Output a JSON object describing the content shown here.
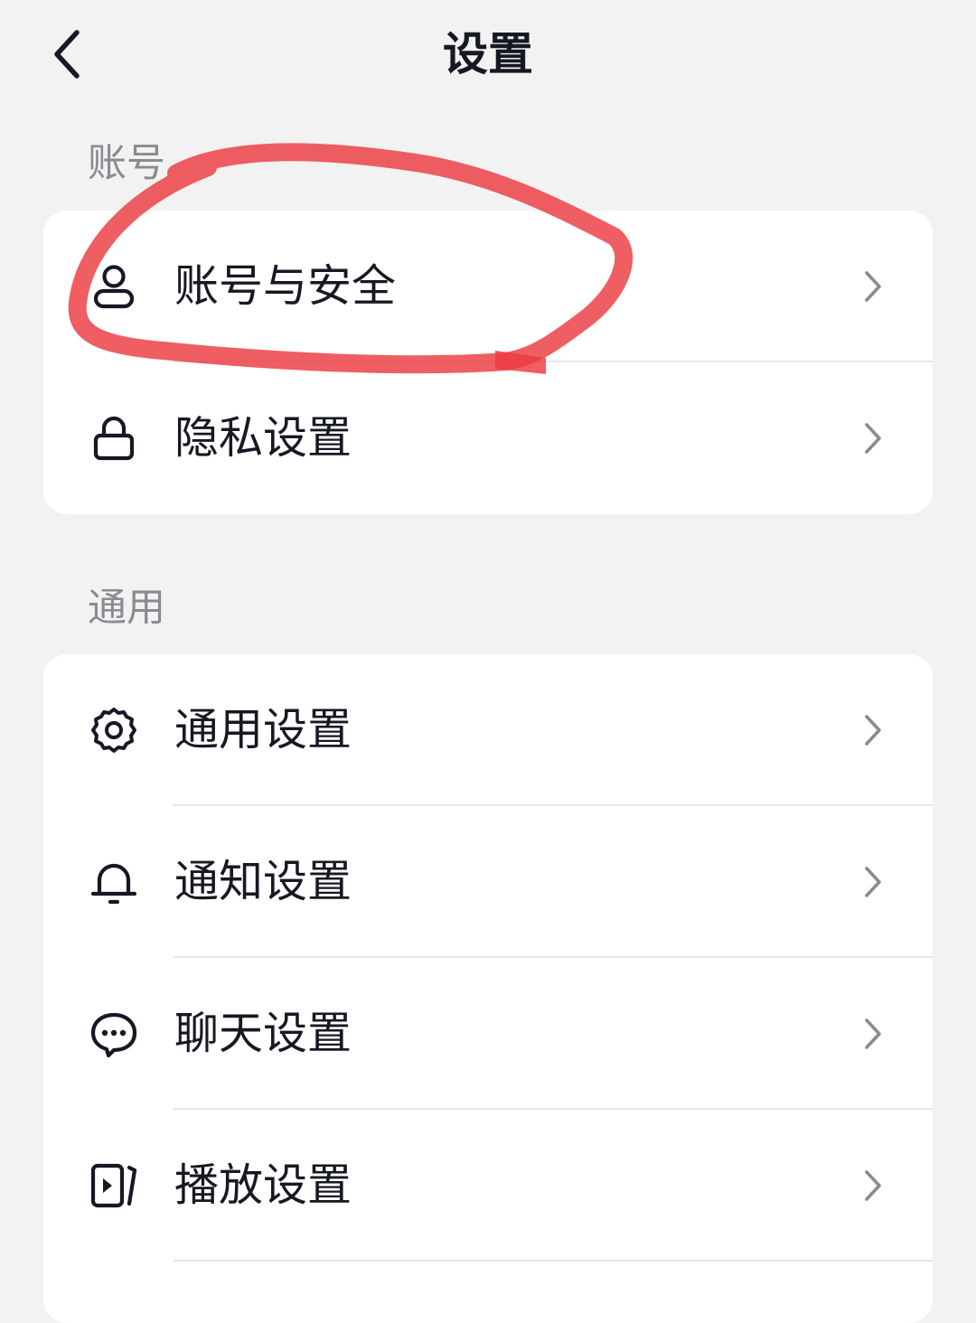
{
  "header": {
    "title": "设置",
    "back_icon": "chevron-left-icon"
  },
  "sections": [
    {
      "label": "账号",
      "items": [
        {
          "label": "账号与安全",
          "icon": "user-icon"
        },
        {
          "label": "隐私设置",
          "icon": "lock-icon"
        }
      ]
    },
    {
      "label": "通用",
      "items": [
        {
          "label": "通用设置",
          "icon": "gear-icon"
        },
        {
          "label": "通知设置",
          "icon": "bell-icon"
        },
        {
          "label": "聊天设置",
          "icon": "chat-bubble-icon"
        },
        {
          "label": "播放设置",
          "icon": "play-screen-icon"
        }
      ]
    }
  ],
  "chevron_icon": "chevron-right-icon",
  "annotation": {
    "type": "hand-drawn circle",
    "target": "账号与安全",
    "color": "#ec3a3f"
  },
  "colors": {
    "background": "#f2f2f2",
    "card": "#ffffff",
    "text_primary": "#161823",
    "text_secondary": "#8a8b91",
    "divider": "#e6e6e8",
    "annotation": "#ec3a3f"
  }
}
